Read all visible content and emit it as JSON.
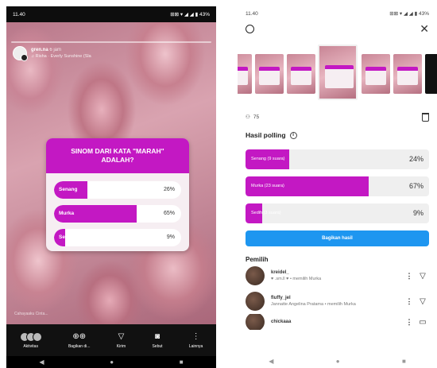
{
  "left": {
    "status": {
      "time": "11.40",
      "icons": "⊞⊠ ▾ ◢ ◢ ▮ 43%"
    },
    "story": {
      "username": "gren.na",
      "time_ago": "6 jam",
      "music": "♫ Risha · Everly Sunshine (Sla",
      "caption": "Cahayaaku Cinta..."
    },
    "poll": {
      "question": "SINOM DARI KATA \"MARAH\" ADALAH?",
      "options": [
        {
          "label": "Senang",
          "percent": "26%",
          "value": 26
        },
        {
          "label": "Murka",
          "percent": "65%",
          "value": 65
        },
        {
          "label": "Sedih",
          "percent": "9%",
          "value": 9
        }
      ]
    },
    "toolbar": {
      "activity": "Aktivitas",
      "share": "Bagikan di...",
      "send": "Kirim",
      "mention": "Sebut",
      "more": "Lainnya"
    }
  },
  "right": {
    "status": {
      "time": "11.40",
      "icons": "⊞⊠ ▾ ◢ ◢ ▮ 43%"
    },
    "viewers_count": "75",
    "results_title": "Hasil polling",
    "results": [
      {
        "label": "Senang (9 suara)",
        "percent": "24%",
        "value": 24
      },
      {
        "label": "Murka (23 suara)",
        "percent": "67%",
        "value": 67
      },
      {
        "label": "Sedih (3 suara)",
        "percent": "9%",
        "value": 9
      }
    ],
    "share_result_label": "Bagikan hasil",
    "voters_title": "Pemilih",
    "voters": [
      {
        "name": "kreidel_",
        "sub": "♥ .sm.ll ♥ • memilih Murka"
      },
      {
        "name": "fluffy_jel",
        "sub": "Jannatte Angelina Pratama • memilih Murka"
      },
      {
        "name": "chickaaa",
        "sub": ""
      }
    ]
  },
  "colors": {
    "accent": "#c318c3",
    "button_blue": "#1e96f0"
  }
}
